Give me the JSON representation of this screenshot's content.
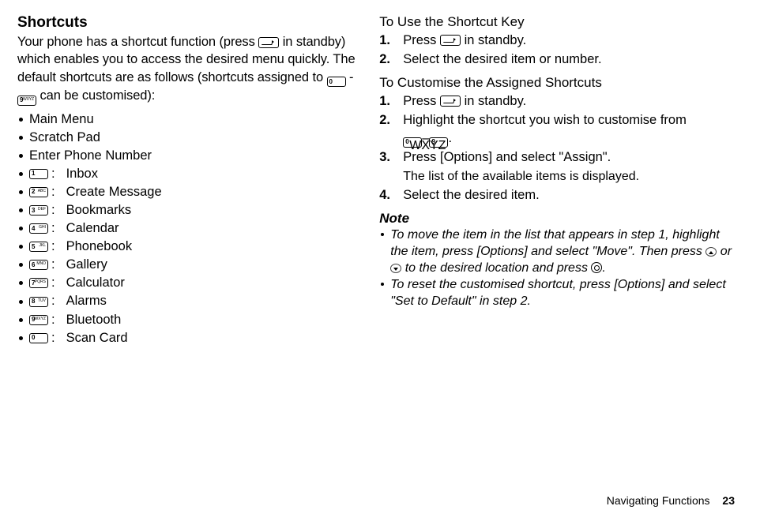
{
  "left": {
    "title": "Shortcuts",
    "intro_pre": "Your phone has a shortcut function (press ",
    "intro_mid": " in standby) which enables you to access the desired menu quickly. The default shortcuts are as follows (shortcuts assigned to ",
    "intro_dash": "-",
    "intro_post": " can be customised):",
    "plain_items": [
      "Main Menu",
      "Scratch Pad",
      "Enter Phone Number"
    ],
    "key_items": [
      {
        "key": "1",
        "sub": "",
        "label": "Inbox"
      },
      {
        "key": "2",
        "sub": "ABC",
        "label": "Create Message"
      },
      {
        "key": "3",
        "sub": "DEF",
        "label": "Bookmarks"
      },
      {
        "key": "4",
        "sub": "GHI",
        "label": "Calendar"
      },
      {
        "key": "5",
        "sub": "JKL",
        "label": "Phonebook"
      },
      {
        "key": "6",
        "sub": "MNO",
        "label": "Gallery"
      },
      {
        "key": "7",
        "sub": "PQRS",
        "label": "Calculator"
      },
      {
        "key": "8",
        "sub": "TUV",
        "label": "Alarms"
      },
      {
        "key": "9",
        "sub": "WXYZ",
        "label": "Bluetooth"
      },
      {
        "key": "0",
        "sub": "",
        "label": "Scan Card"
      }
    ],
    "key0": {
      "num": "0",
      "sub": ""
    },
    "key9": {
      "num": "9",
      "sub": "WXYZ"
    }
  },
  "right": {
    "use_title": "To Use the Shortcut Key",
    "use_steps": [
      {
        "n": "1.",
        "pre": "Press ",
        "post": " in standby."
      },
      {
        "n": "2.",
        "text": "Select the desired item or number."
      }
    ],
    "cust_title": "To Customise the Assigned Shortcuts",
    "cust_steps": [
      {
        "n": "1.",
        "pre": "Press ",
        "post": " in standby."
      },
      {
        "n": "2.",
        "pre": "Highlight the shortcut you wish to customise from ",
        "mid": "–",
        "post": "."
      },
      {
        "n": "3.",
        "text": "Press [Options] and select \"Assign\".",
        "sub": "The list of the available items is displayed."
      },
      {
        "n": "4.",
        "text": "Select the desired item."
      }
    ],
    "note_label": "Note",
    "notes": [
      {
        "pre": "To move the item in the list that appears in step 1, highlight the item, press [Options] and select \"Move\". Then press ",
        "mid": " or ",
        "post": " to the desired location and press ",
        "end": "."
      },
      {
        "text": "To reset the customised shortcut, press [Options] and select \"Set to Default\" in step 2."
      }
    ]
  },
  "footer": {
    "section": "Navigating Functions",
    "page": "23"
  }
}
